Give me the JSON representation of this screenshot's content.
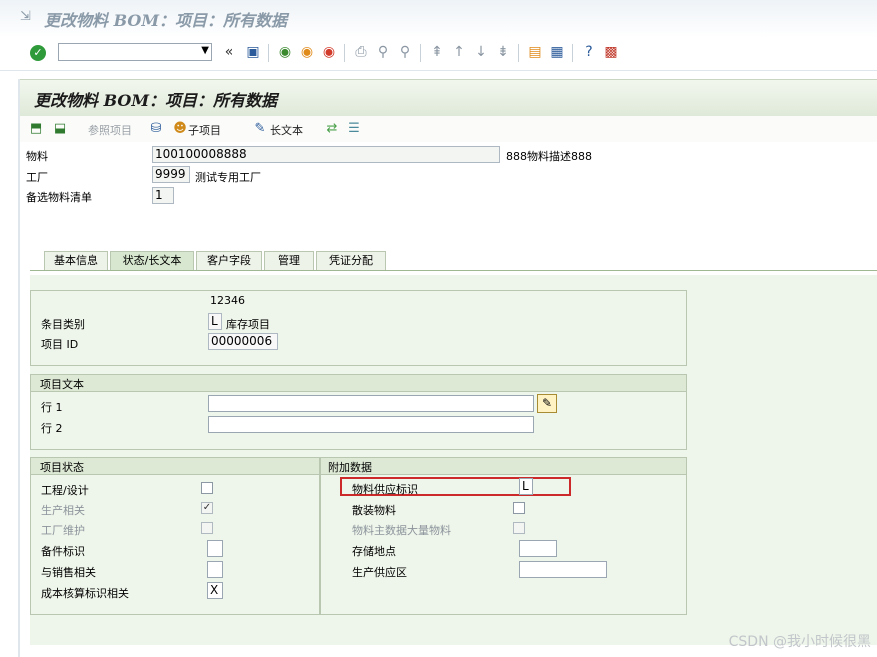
{
  "window": {
    "title": "更改物料 BOM：项目：所有数据"
  },
  "system_toolbar": {
    "command_field": {
      "value": "",
      "placeholder": ""
    },
    "icons": [
      "enter-icon",
      "back-icon",
      "save-icon",
      "back-green-icon",
      "exit-icon",
      "cancel-icon",
      "print-icon",
      "find-icon",
      "find-next-icon",
      "first-page-icon",
      "prev-page-icon",
      "next-page-icon",
      "last-page-icon",
      "new-session-icon",
      "shortcut-icon",
      "help-icon",
      "layout-icon"
    ]
  },
  "screen": {
    "title": "更改物料 BOM：项目：所有数据"
  },
  "app_toolbar": {
    "reference_item": "参照项目",
    "sub_item": "子项目",
    "long_text": "长文本"
  },
  "header": {
    "material_label": "物料",
    "material_value": "100100008888",
    "material_desc": "888物料描述888",
    "plant_label": "工厂",
    "plant_value": "9999",
    "plant_desc": "测试专用工厂",
    "alt_bom_label": "备选物料清单",
    "alt_bom_value": "1"
  },
  "tabs": [
    {
      "label": "基本信息",
      "active": false
    },
    {
      "label": "状态/长文本",
      "active": true
    },
    {
      "label": "客户字段",
      "active": false
    },
    {
      "label": "管理",
      "active": false
    },
    {
      "label": "凭证分配",
      "active": false
    }
  ],
  "item_info": {
    "number": "12346",
    "category_label": "条目类别",
    "category_value": "L",
    "category_desc": "库存项目",
    "item_id_label": "项目 ID",
    "item_id_value": "00000006"
  },
  "item_text": {
    "title": "项目文本",
    "line1_label": "行 1",
    "line1_value": "",
    "line2_label": "行 2",
    "line2_value": ""
  },
  "item_status": {
    "title": "项目状态",
    "engineering_label": "工程/设计",
    "production_label": "生产相关",
    "plant_maint_label": "工厂维护",
    "spare_label": "备件标识",
    "sales_label": "与销售相关",
    "costing_label": "成本核算标识相关",
    "costing_value": "X"
  },
  "additional": {
    "title": "附加数据",
    "supply_label": "物料供应标识",
    "supply_value": "L",
    "bulk_label": "散装物料",
    "bulk_master_label": "物料主数据大量物料",
    "storage_label": "存储地点",
    "storage_value": "",
    "supply_area_label": "生产供应区",
    "supply_area_value": ""
  },
  "watermark": "CSDN @我小时候很黑",
  "colors": {
    "highlight": "#cc2a2a",
    "panel": "#eef5ea",
    "ok": "#2f9a3a"
  }
}
